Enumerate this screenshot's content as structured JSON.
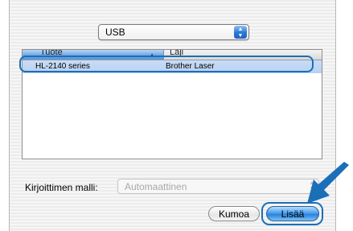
{
  "connection": {
    "selected": "USB"
  },
  "printer_list": {
    "columns": [
      "Tuote",
      "Laji"
    ],
    "rows": [
      {
        "product": "HL-2140 series",
        "type": "Brother Laser"
      }
    ]
  },
  "model": {
    "label": "Kirjoittimen malli:",
    "value": "Automaattinen"
  },
  "buttons": {
    "cancel": "Kumoa",
    "add": "Lisää"
  },
  "colors": {
    "highlight_ring": "#1a6fb8",
    "selection": "#b8d1f2",
    "primary_button": "#3f97ea"
  }
}
